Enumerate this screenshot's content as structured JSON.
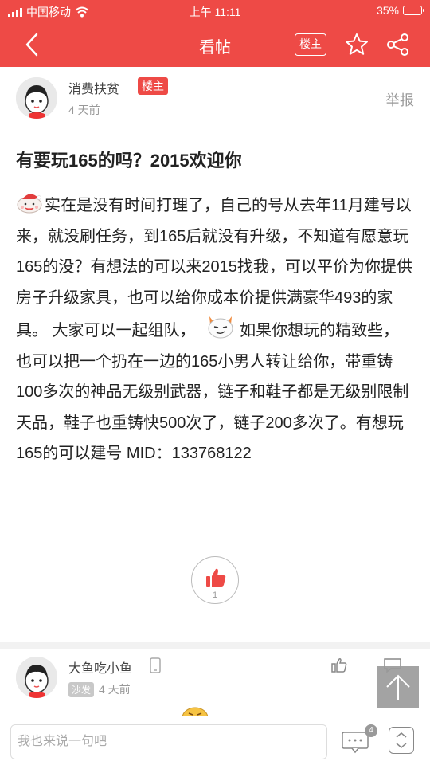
{
  "status_bar": {
    "carrier": "中国移动",
    "time": "上午 11:11",
    "battery": "35%",
    "battery_level": 0.35
  },
  "nav": {
    "title": "看帖",
    "owner_filter_label": "楼主",
    "back_icon": "chevron-left-icon",
    "star_icon": "star-outline-icon",
    "share_icon": "share-icon"
  },
  "post": {
    "author": "消费扶贫",
    "owner_badge": "楼主",
    "time": "4 天前",
    "report_label": "举报",
    "title": "有要玩165的吗？2015欢迎你",
    "body_1": "实在是没有时间打理了，自己的号从去年11月建号以来，就没刷任务，到165后就没有升级，不知道有愿意玩165的没？有想法的可以来2015找我，可以平价为你提供房子升级家具，也可以给你成本价提供满豪华493的家具。 大家可以一起组队，",
    "body_2": " 如果你想玩的精致些，也可以把一个扔在一边的165小男人转让给你，带重铸100多次的神品无级别武器，链子和鞋子都是无级别限制天品，鞋子也重铸快500次了，链子200多次了。有想玩165的可以建号 MID：133768122",
    "like_count": "1"
  },
  "reply": {
    "author": "大鱼吃小鱼",
    "floor_badge": "沙发",
    "time": "4 天前"
  },
  "bottom_bar": {
    "input_placeholder": "我也来说一句吧",
    "comment_count": "4"
  },
  "colors": {
    "brand_red": "#ee4a46",
    "muted_gray": "#999999"
  }
}
